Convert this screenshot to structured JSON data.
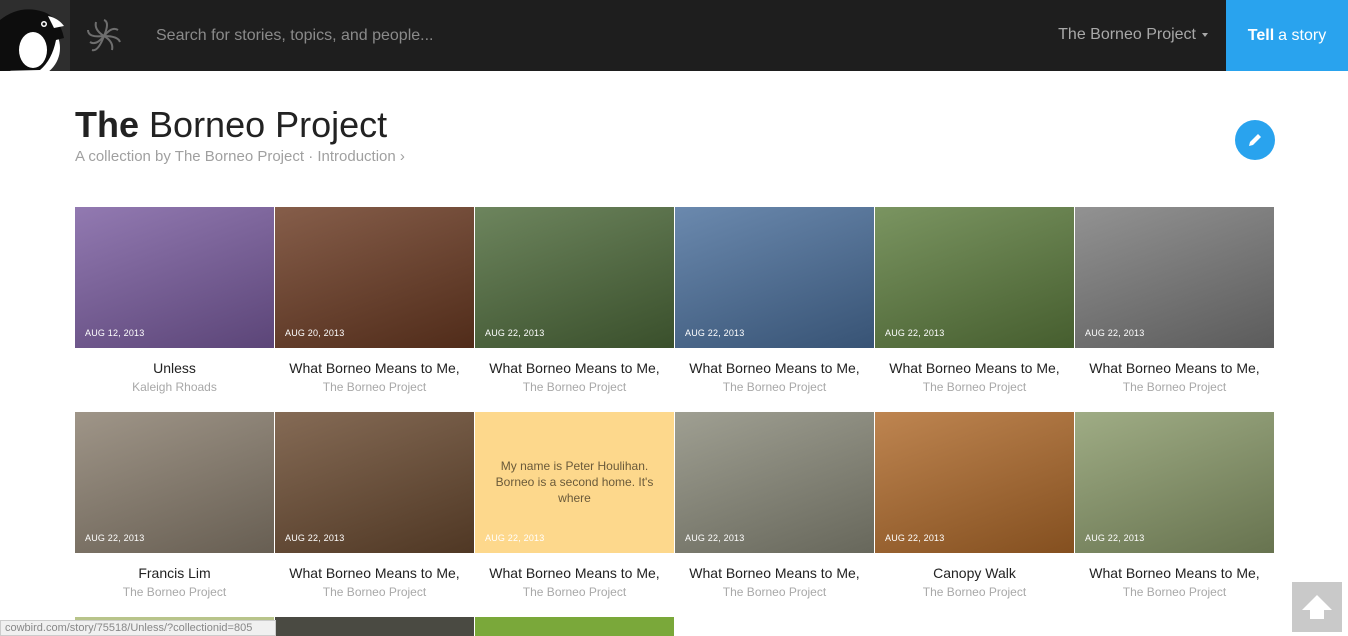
{
  "header": {
    "search_placeholder": "Search for stories, topics, and people...",
    "user_menu_label": "The Borneo Project",
    "tell_bold": "Tell",
    "tell_rest": "a story"
  },
  "collection": {
    "title_bold": "The",
    "title_rest": "Borneo Project",
    "subtitle": "A collection by The Borneo Project · Introduction ›"
  },
  "stories": [
    {
      "date": "AUG 12, 2013",
      "title": "Unless",
      "author": "Kaleigh Rhoads",
      "bg": "#7a5ca0"
    },
    {
      "date": "AUG 20, 2013",
      "title": "What Borneo Means to Me,",
      "author": "The Borneo Project",
      "bg": "#6b3a22"
    },
    {
      "date": "AUG 22, 2013",
      "title": "What Borneo Means to Me,",
      "author": "The Borneo Project",
      "bg": "#4d6a3a"
    },
    {
      "date": "AUG 22, 2013",
      "title": "What Borneo Means to Me,",
      "author": "The Borneo Project",
      "bg": "#4a6f9c"
    },
    {
      "date": "AUG 22, 2013",
      "title": "What Borneo Means to Me,",
      "author": "The Borneo Project",
      "bg": "#5d7d3e"
    },
    {
      "date": "AUG 22, 2013",
      "title": "What Borneo Means to Me,",
      "author": "The Borneo Project",
      "bg": "#7a7a7a"
    },
    {
      "date": "AUG 22, 2013",
      "title": "Francis Lim",
      "author": "The Borneo Project",
      "bg": "#8a7e6e"
    },
    {
      "date": "AUG 22, 2013",
      "title": "What Borneo Means to Me,",
      "author": "The Borneo Project",
      "bg": "#6a4a30"
    },
    {
      "date": "AUG 22, 2013",
      "title": "What Borneo Means to Me,",
      "author": "The Borneo Project",
      "bg": "#fdd88c",
      "quote": "My name is Peter Houlihan. Borneo is a second home. It's where"
    },
    {
      "date": "AUG 22, 2013",
      "title": "What Borneo Means to Me,",
      "author": "The Borneo Project",
      "bg": "#8a8a7a"
    },
    {
      "date": "AUG 22, 2013",
      "title": "Canopy Walk",
      "author": "The Borneo Project",
      "bg": "#b06a2a"
    },
    {
      "date": "AUG 22, 2013",
      "title": "What Borneo Means to Me,",
      "author": "The Borneo Project",
      "bg": "#8a9a6a"
    }
  ],
  "status_url": "cowbird.com/story/75518/Unless/?collectionid=805"
}
